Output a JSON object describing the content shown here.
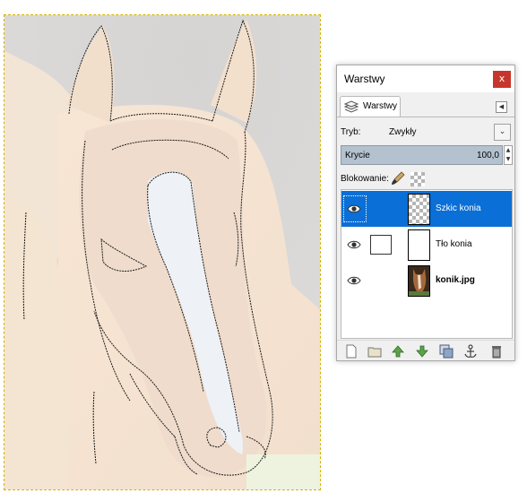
{
  "dialog": {
    "title": "Warstwy",
    "close_label": "x",
    "tab_label": "Warstwy",
    "tab_menu_label": "◀",
    "mode_label": "Tryb:",
    "mode_value": "Zwykły",
    "opacity_label": "Krycie",
    "opacity_value": "100,0",
    "lock_label": "Blokowanie:"
  },
  "layers": [
    {
      "name": "Szkic konia",
      "selected": true,
      "visible": true
    },
    {
      "name": "Tło konia",
      "selected": false,
      "visible": true
    },
    {
      "name": "konik.jpg",
      "selected": false,
      "visible": true,
      "bold": true
    }
  ],
  "toolbar": {
    "icons": [
      "new-layer-icon",
      "new-group-icon",
      "raise-layer-icon",
      "lower-layer-icon",
      "duplicate-layer-icon",
      "anchor-layer-icon",
      "delete-layer-icon"
    ]
  },
  "colors": {
    "selection": "#0a6fd6",
    "close_button": "#c7362c",
    "opacity_bar": "#b4c2cf"
  }
}
